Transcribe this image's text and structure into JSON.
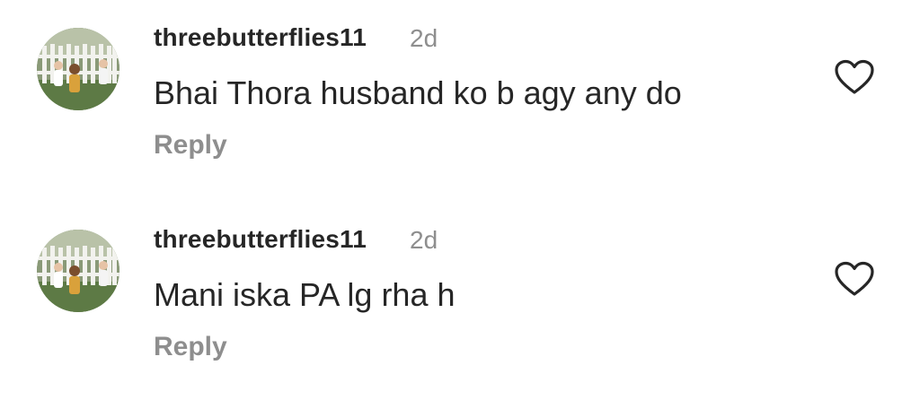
{
  "comments": [
    {
      "username": "threebutterflies11",
      "time": "2d",
      "text": "Bhai Thora husband ko b agy any do",
      "reply_label": "Reply",
      "like_icon": "heart-outline-icon",
      "avatar": "profile-photo-avatar"
    },
    {
      "username": "threebutterflies11",
      "time": "2d",
      "text": "Mani iska PA lg rha h",
      "reply_label": "Reply",
      "like_icon": "heart-outline-icon",
      "avatar": "profile-photo-avatar"
    }
  ],
  "colors": {
    "primary_text": "#262626",
    "secondary_text": "#8e8e8e",
    "background": "#ffffff"
  }
}
